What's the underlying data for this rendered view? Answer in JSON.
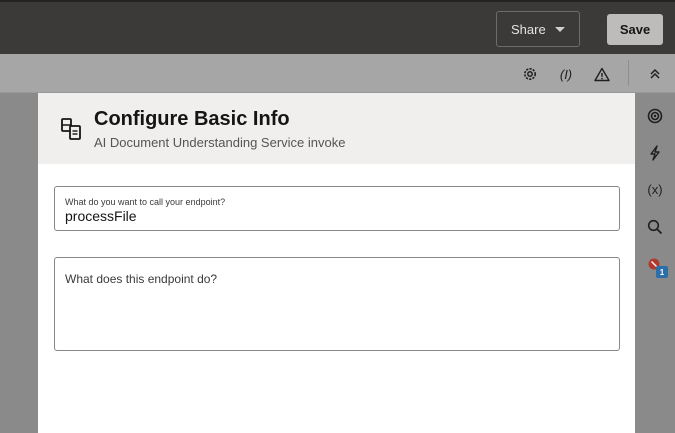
{
  "header": {
    "share_label": "Share",
    "save_label": "Save"
  },
  "toolbar": {
    "icons": [
      "gear-icon",
      "inspect-variable-icon",
      "warning-icon",
      "collapse-up-icon"
    ],
    "inspect_label": "(I)"
  },
  "panel": {
    "icon": "api-document-icon",
    "title": "Configure Basic Info",
    "subtitle": "AI Document Understanding Service invoke",
    "name_field": {
      "label": "What do you want to call your endpoint?",
      "value": "processFile"
    },
    "description_field": {
      "placeholder": "What does this endpoint do?"
    }
  },
  "right_rail": {
    "icons": [
      "target-icon",
      "lightning-icon",
      "variables-icon",
      "search-icon",
      "error-flag-icon"
    ],
    "variables_label": "(x)",
    "error_count": "1"
  },
  "colors": {
    "topbar": "#3b3a39",
    "toolbar": "#a6a6a6",
    "panel_header": "#f1efed",
    "badge": "#2b6ea8",
    "error": "#b03a2e"
  }
}
